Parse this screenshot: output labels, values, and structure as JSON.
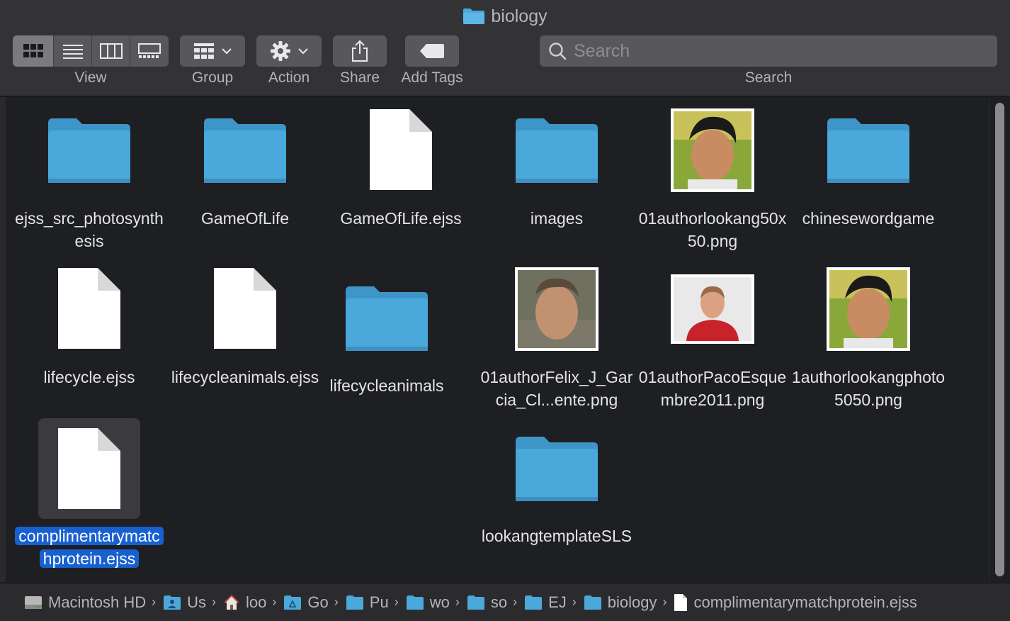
{
  "window": {
    "title": "biology"
  },
  "toolbar": {
    "view_label": "View",
    "group_label": "Group",
    "action_label": "Action",
    "share_label": "Share",
    "add_tags_label": "Add Tags",
    "search_label": "Search",
    "search_placeholder": "Search"
  },
  "files": [
    {
      "name": "ejss_src_photosynthesis",
      "kind": "folder"
    },
    {
      "name": "GameOfLife",
      "kind": "folder"
    },
    {
      "name": "GameOfLife.ejss",
      "kind": "document"
    },
    {
      "name": "images",
      "kind": "folder"
    },
    {
      "name": "01authorlookang50x50.png",
      "kind": "image"
    },
    {
      "name": "chinesewordgame",
      "kind": "folder"
    },
    {
      "name": "lifecycle.ejss",
      "kind": "document"
    },
    {
      "name": "lifecycleanimals.ejss",
      "kind": "document"
    },
    {
      "name": "lifecycleanimals",
      "kind": "folder"
    },
    {
      "name": "01authorFelix_J_Garcia_Cl...ente.png",
      "kind": "image"
    },
    {
      "name": "01authorPacoEsquembre2011.png",
      "kind": "image"
    },
    {
      "name": "1authorlookangphoto5050.png",
      "kind": "image"
    },
    {
      "name": "complimentarymatchprotein.ejss",
      "kind": "document",
      "selected": true
    },
    {
      "name": "lookangtemplateSLS",
      "kind": "folder"
    }
  ],
  "pathbar": [
    {
      "label": "Macintosh HD",
      "icon": "hard-drive-icon"
    },
    {
      "label": "Us",
      "icon": "users-folder-icon"
    },
    {
      "label": "loo",
      "icon": "home-icon"
    },
    {
      "label": "Go",
      "icon": "drive-folder-icon"
    },
    {
      "label": "Pu",
      "icon": "folder-icon"
    },
    {
      "label": "wo",
      "icon": "folder-icon"
    },
    {
      "label": "so",
      "icon": "folder-icon"
    },
    {
      "label": "EJ",
      "icon": "folder-icon"
    },
    {
      "label": "biology",
      "icon": "folder-icon"
    },
    {
      "label": "complimentarymatchprotein.ejss",
      "icon": "document-icon"
    }
  ],
  "colors": {
    "folder": "#4aa8db",
    "selection": "#1860d0",
    "toolbar": "#333336",
    "background": "#1e1f22"
  }
}
